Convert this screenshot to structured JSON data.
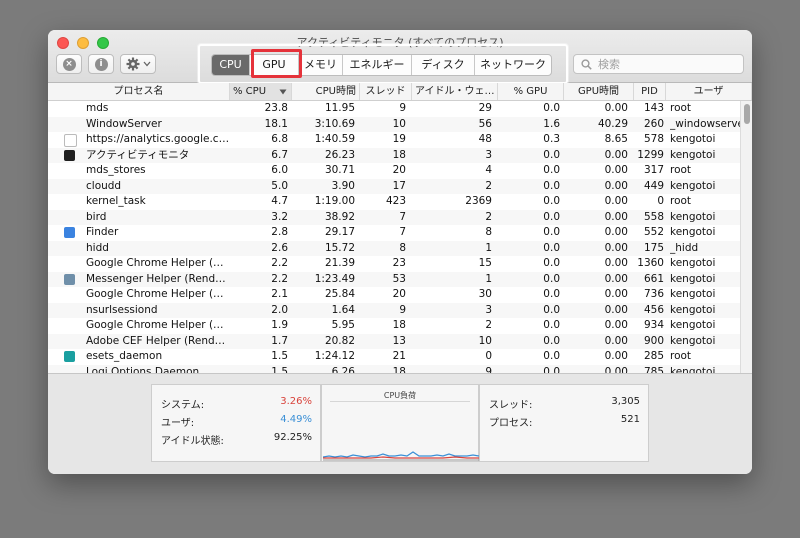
{
  "window": {
    "title": "アクティビティモニタ (すべてのプロセス)"
  },
  "toolbar": {
    "stop_icon": "x-circle-icon",
    "info_icon": "info-icon",
    "gear_icon": "gear-icon",
    "tabs": [
      "CPU",
      "GPU",
      "メモリ",
      "エネルギー",
      "ディスク",
      "ネットワーク"
    ],
    "active_tab": "CPU",
    "search_placeholder": "検索"
  },
  "table": {
    "columns": [
      "プロセス名",
      "% CPU",
      "CPU時間",
      "スレッド",
      "アイドル・ウェ…",
      "% GPU",
      "GPU時間",
      "PID",
      "ユーザ"
    ],
    "sort_direction_icon": "sort-desc-icon",
    "rows": [
      [
        "mds",
        "23.8",
        "11.95",
        "9",
        "29",
        "0.0",
        "0.00",
        "143",
        "root"
      ],
      [
        "WindowServer",
        "18.1",
        "3:10.69",
        "10",
        "56",
        "1.6",
        "40.29",
        "260",
        "_windowserver"
      ],
      [
        "https://analytics.google.com",
        "6.8",
        "1:40.59",
        "19",
        "48",
        "0.3",
        "8.65",
        "578",
        "kengotoi"
      ],
      [
        "アクティビティモニタ",
        "6.7",
        "26.23",
        "18",
        "3",
        "0.0",
        "0.00",
        "1299",
        "kengotoi"
      ],
      [
        "mds_stores",
        "6.0",
        "30.71",
        "20",
        "4",
        "0.0",
        "0.00",
        "317",
        "root"
      ],
      [
        "cloudd",
        "5.0",
        "3.90",
        "17",
        "2",
        "0.0",
        "0.00",
        "449",
        "kengotoi"
      ],
      [
        "kernel_task",
        "4.7",
        "1:19.00",
        "423",
        "2369",
        "0.0",
        "0.00",
        "0",
        "root"
      ],
      [
        "bird",
        "3.2",
        "38.92",
        "7",
        "2",
        "0.0",
        "0.00",
        "558",
        "kengotoi"
      ],
      [
        "Finder",
        "2.8",
        "29.17",
        "7",
        "8",
        "0.0",
        "0.00",
        "552",
        "kengotoi"
      ],
      [
        "hidd",
        "2.6",
        "15.72",
        "8",
        "1",
        "0.0",
        "0.00",
        "175",
        "_hidd"
      ],
      [
        "Google Chrome Helper (Renderer)",
        "2.2",
        "21.39",
        "23",
        "15",
        "0.0",
        "0.00",
        "1360",
        "kengotoi"
      ],
      [
        "Messenger Helper (Renderer)",
        "2.2",
        "1:23.49",
        "53",
        "1",
        "0.0",
        "0.00",
        "661",
        "kengotoi"
      ],
      [
        "Google Chrome Helper (Renderer)",
        "2.1",
        "25.84",
        "20",
        "30",
        "0.0",
        "0.00",
        "736",
        "kengotoi"
      ],
      [
        "nsurlsessiond",
        "2.0",
        "1.64",
        "9",
        "3",
        "0.0",
        "0.00",
        "456",
        "kengotoi"
      ],
      [
        "Google Chrome Helper (Renderer)",
        "1.9",
        "5.95",
        "18",
        "2",
        "0.0",
        "0.00",
        "934",
        "kengotoi"
      ],
      [
        "Adobe CEF Helper (Renderer)",
        "1.7",
        "20.82",
        "13",
        "10",
        "0.0",
        "0.00",
        "900",
        "kengotoi"
      ],
      [
        "esets_daemon",
        "1.5",
        "1:24.12",
        "21",
        "0",
        "0.0",
        "0.00",
        "285",
        "root"
      ],
      [
        "Logi Options Daemon",
        "1.5",
        "6.26",
        "18",
        "9",
        "0.0",
        "0.00",
        "785",
        "kengotoi"
      ]
    ],
    "row_icons": {
      "2": {
        "name": "document-icon",
        "color": "#ffffff"
      },
      "3": {
        "name": "activity-monitor-icon",
        "color": "#1f1f1f"
      },
      "8": {
        "name": "finder-icon",
        "color": "#3b83e0"
      },
      "11": {
        "name": "messenger-icon",
        "color": "#6f8fa9"
      },
      "16": {
        "name": "eset-icon",
        "color": "#1a9fa0"
      }
    }
  },
  "footer": {
    "system_label": "システム:",
    "system_value": "3.26%",
    "system_color": "#d9443c",
    "user_label": "ユーザ:",
    "user_value": "4.49%",
    "user_color": "#3a8fd6",
    "idle_label": "アイドル状態:",
    "idle_value": "92.25%",
    "graph_title": "CPU負荷",
    "threads_label": "スレッド:",
    "threads_value": "3,305",
    "processes_label": "プロセス:",
    "processes_value": "521"
  }
}
